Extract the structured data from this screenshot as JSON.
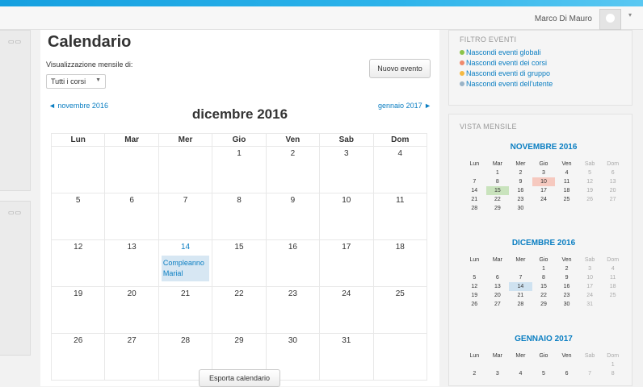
{
  "header": {
    "user_name": "Marco Di Mauro",
    "caret": "▾"
  },
  "left_blocks": [
    {
      "icon": "▭▭"
    },
    {
      "icon": "▭▭"
    }
  ],
  "main": {
    "title": "Calendario",
    "view_label": "Visualizzazione mensile di:",
    "course_select": "Tutti i corsi",
    "new_event_label": "Nuovo evento",
    "prev_month_label": "◄ novembre 2016",
    "next_month_label": "gennaio 2017 ►",
    "month_title": "dicembre 2016",
    "weekdays": [
      "Lun",
      "Mar",
      "Mer",
      "Gio",
      "Ven",
      "Sab",
      "Dom"
    ],
    "weeks": [
      [
        "",
        "",
        "",
        "1",
        "2",
        "3",
        "4"
      ],
      [
        "5",
        "6",
        "7",
        "8",
        "9",
        "10",
        "11"
      ],
      [
        "12",
        "13",
        "14",
        "15",
        "16",
        "17",
        "18"
      ],
      [
        "19",
        "20",
        "21",
        "22",
        "23",
        "24",
        "25"
      ],
      [
        "26",
        "27",
        "28",
        "29",
        "30",
        "31",
        ""
      ]
    ],
    "event": {
      "day": "14",
      "label": "Compleanno Marial"
    },
    "export_label": "Esporta calendario"
  },
  "filter": {
    "title": "FILTRO EVENTI",
    "items": [
      {
        "label": "Nascondi eventi globali",
        "color": "#8bc34a"
      },
      {
        "label": "Nascondi eventi dei corsi",
        "color": "#f08a6c"
      },
      {
        "label": "Nascondi eventi di gruppo",
        "color": "#f5b942"
      },
      {
        "label": "Nascondi eventi dell'utente",
        "color": "#9ab3c6"
      }
    ]
  },
  "month_view": {
    "title": "VISTA MENSILE",
    "weekdays": [
      "Lun",
      "Mar",
      "Mer",
      "Gio",
      "Ven",
      "Sab",
      "Dom"
    ],
    "months": [
      {
        "name": "NOVEMBRE 2016",
        "weeks": [
          [
            "",
            "1",
            "2",
            "3",
            "4",
            "5",
            "6"
          ],
          [
            "7",
            "8",
            "9",
            "10",
            "11",
            "12",
            "13"
          ],
          [
            "14",
            "15",
            "16",
            "17",
            "18",
            "19",
            "20"
          ],
          [
            "21",
            "22",
            "23",
            "24",
            "25",
            "26",
            "27"
          ],
          [
            "28",
            "29",
            "30",
            "",
            "",
            "",
            ""
          ]
        ]
      },
      {
        "name": "DICEMBRE 2016",
        "weeks": [
          [
            "",
            "",
            "",
            "1",
            "2",
            "3",
            "4"
          ],
          [
            "5",
            "6",
            "7",
            "8",
            "9",
            "10",
            "11"
          ],
          [
            "12",
            "13",
            "14",
            "15",
            "16",
            "17",
            "18"
          ],
          [
            "19",
            "20",
            "21",
            "22",
            "23",
            "24",
            "25"
          ],
          [
            "26",
            "27",
            "28",
            "29",
            "30",
            "31",
            ""
          ]
        ]
      },
      {
        "name": "GENNAIO 2017",
        "weeks": [
          [
            "",
            "",
            "",
            "",
            "",
            "",
            "1"
          ],
          [
            "2",
            "3",
            "4",
            "5",
            "6",
            "7",
            "8"
          ]
        ]
      }
    ],
    "highlights": [
      {
        "month": 0,
        "day": "10",
        "color": "red"
      },
      {
        "month": 0,
        "day": "15",
        "color": "green"
      },
      {
        "month": 1,
        "day": "14",
        "color": "blue"
      }
    ]
  }
}
